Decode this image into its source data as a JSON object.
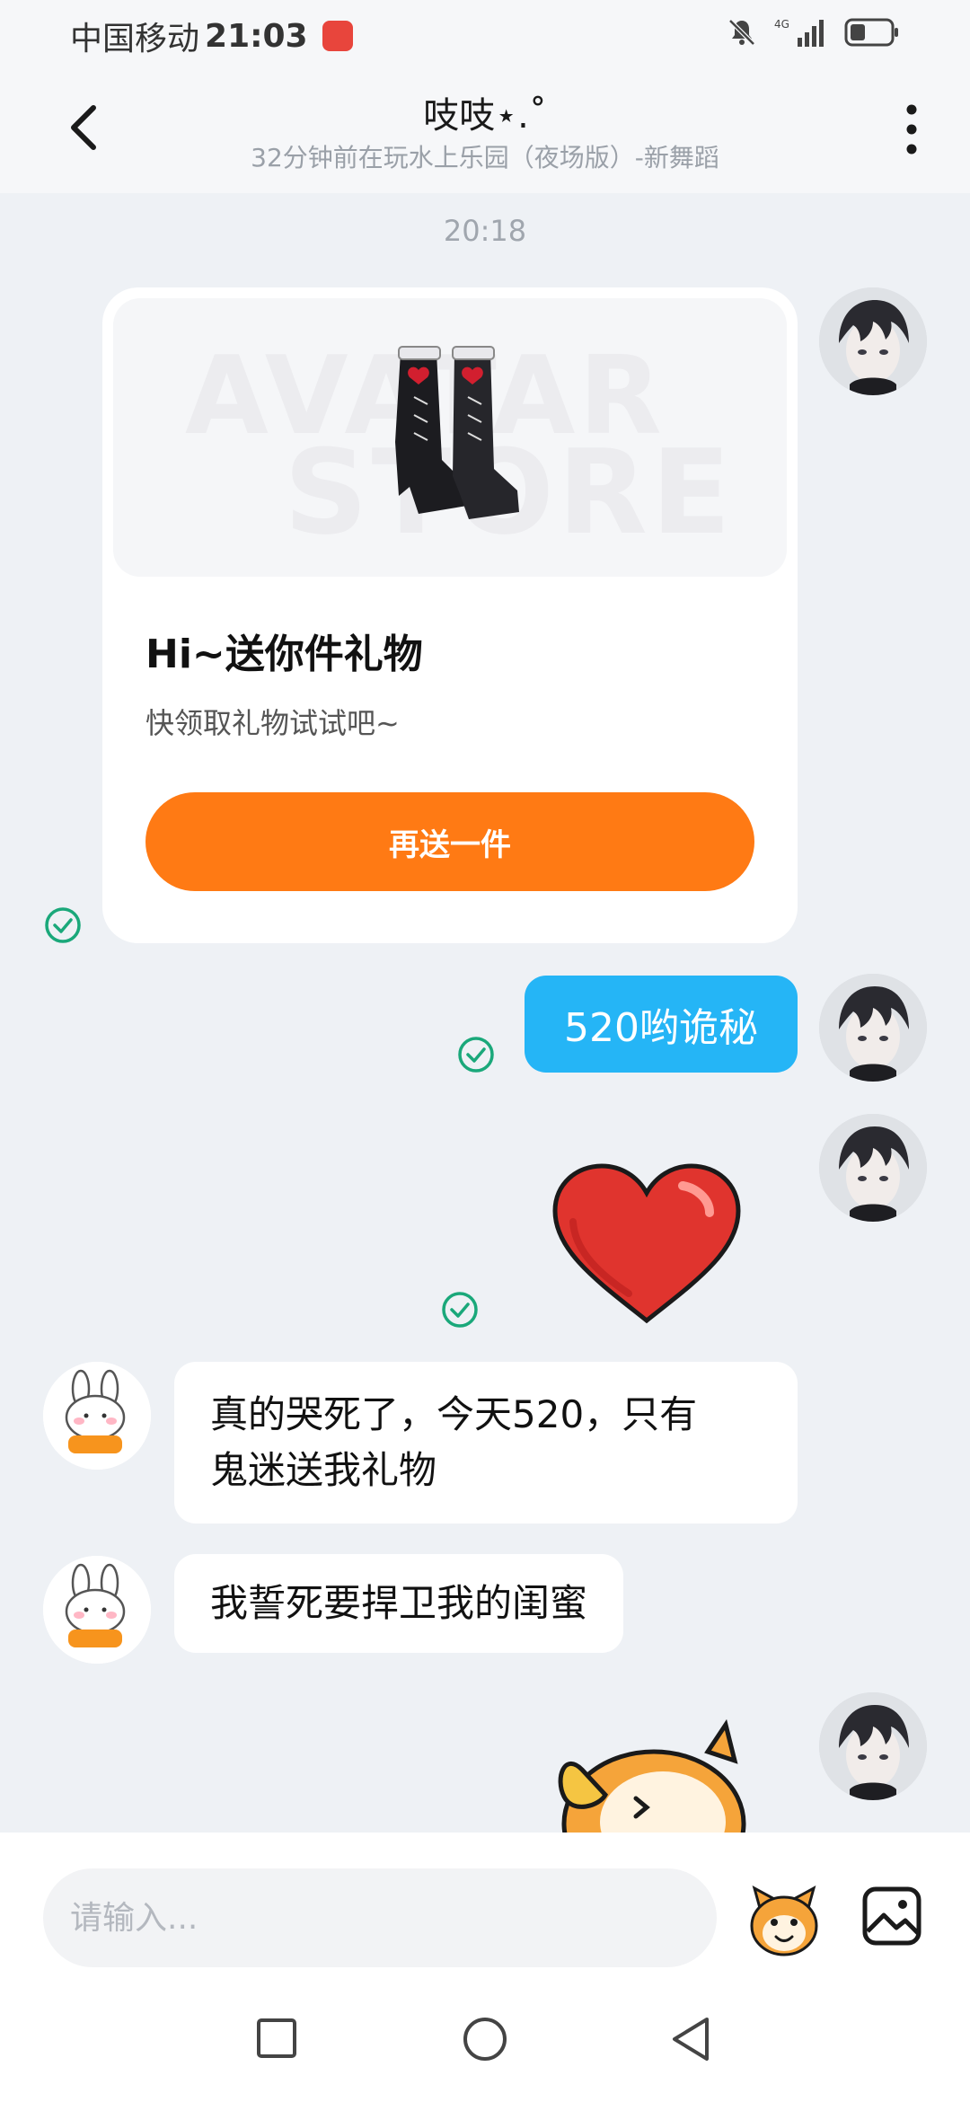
{
  "status_bar": {
    "carrier": "中国移动",
    "time": "21:03",
    "network": "4G"
  },
  "header": {
    "title": "吱吱⋆.˚",
    "subtitle": "32分钟前在玩水上乐园（夜场版）-新舞蹈"
  },
  "messages": {
    "timestamp": "20:18",
    "gift_card": {
      "watermark_line1": "AVATAR",
      "watermark_line2": "STORE",
      "title": "Hi~送你件礼物",
      "description": "快领取礼物试试吧~",
      "button_label": "再送一件"
    },
    "text_sent_1": "520哟诡秘",
    "received_1_line1": "真的哭死了，今天520，只有",
    "received_1_line2": "鬼迷送我礼物",
    "received_2": "我誓死要捍卫我的闺蜜"
  },
  "input": {
    "placeholder": "请输入..."
  },
  "colors": {
    "accent_orange": "#ff7a14",
    "bubble_blue": "#25b5f6",
    "check_green": "#1aa87a",
    "background": "#eef1f5"
  }
}
